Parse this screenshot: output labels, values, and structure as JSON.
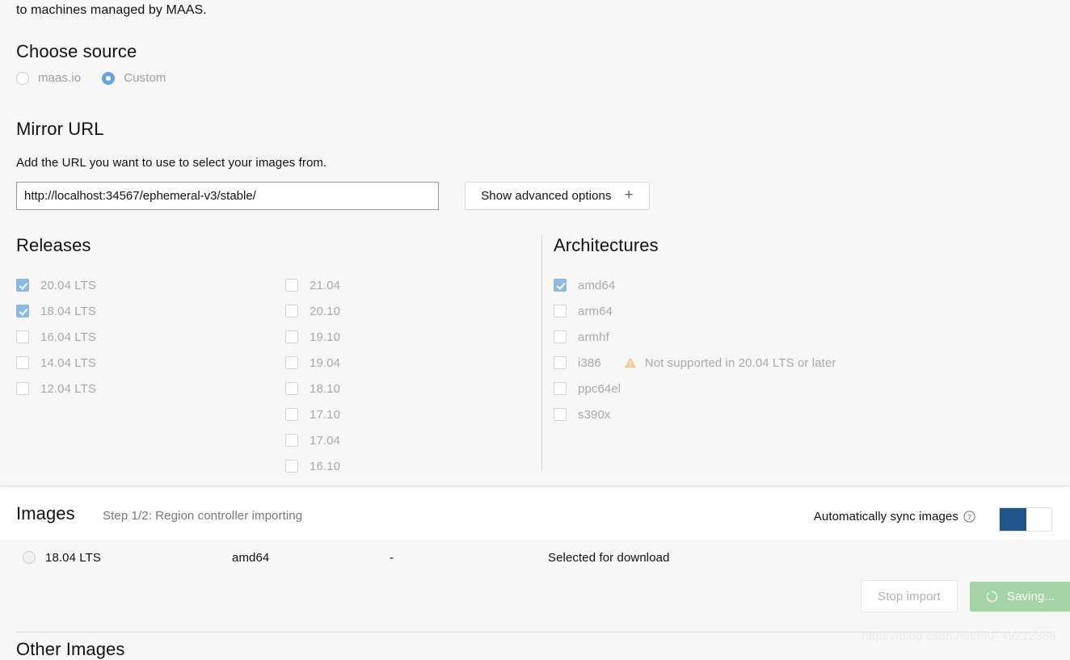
{
  "intro": {
    "text": "to machines managed by MAAS."
  },
  "choose_source": {
    "title": "Choose source",
    "options": [
      {
        "label": "maas.io",
        "selected": false
      },
      {
        "label": "Custom",
        "selected": true
      }
    ]
  },
  "mirror_url": {
    "title": "Mirror URL",
    "help": "Add the URL you want to use to select your images from.",
    "input_value": "http://localhost:34567/ephemeral-v3/stable/",
    "input_placeholder": "",
    "advanced_button": "Show advanced options",
    "advanced_icon": "plus-icon"
  },
  "releases": {
    "title": "Releases",
    "column_a": [
      {
        "label": "20.04 LTS",
        "checked": true
      },
      {
        "label": "18.04 LTS",
        "checked": true
      },
      {
        "label": "16.04 LTS",
        "checked": false
      },
      {
        "label": "14.04 LTS",
        "checked": false
      },
      {
        "label": "12.04 LTS",
        "checked": false
      }
    ],
    "column_b": [
      {
        "label": "21.04",
        "checked": false
      },
      {
        "label": "20.10",
        "checked": false
      },
      {
        "label": "19.10",
        "checked": false
      },
      {
        "label": "19.04",
        "checked": false
      },
      {
        "label": "18.10",
        "checked": false
      },
      {
        "label": "17.10",
        "checked": false
      },
      {
        "label": "17.04",
        "checked": false
      },
      {
        "label": "16.10",
        "checked": false
      }
    ]
  },
  "architectures": {
    "title": "Architectures",
    "items": [
      {
        "label": "amd64",
        "checked": true,
        "warning": ""
      },
      {
        "label": "arm64",
        "checked": false,
        "warning": ""
      },
      {
        "label": "armhf",
        "checked": false,
        "warning": ""
      },
      {
        "label": "i386",
        "checked": false,
        "warning": "Not supported in 20.04 LTS or later"
      },
      {
        "label": "ppc64el",
        "checked": false,
        "warning": ""
      },
      {
        "label": "s390x",
        "checked": false,
        "warning": ""
      }
    ]
  },
  "images_bar": {
    "title": "Images",
    "step": "Step 1/2: Region controller importing",
    "sync_label": "Automatically sync images",
    "help_icon": "question-circle-icon",
    "toggle_on": true
  },
  "images_table": {
    "rows": [
      {
        "release": "18.04 LTS",
        "architecture": "amd64",
        "size": "-",
        "status": "Selected for download"
      }
    ]
  },
  "actions": {
    "stop_import": "Stop import",
    "saving": "Saving...",
    "saving_icon": "spinner-icon"
  },
  "other_images": {
    "title": "Other Images"
  },
  "watermark": {
    "text": "https://blog.csdn.net/m0_49212388"
  },
  "colors": {
    "page_background": "#f7f7f7",
    "bar_background": "#ffffff",
    "radio_selected": "#69a3dd",
    "checkbox_checked": "#8cb8e4",
    "toggle_on": "#20558a",
    "saving_button": "#a4d3a7",
    "warning": "#f3c08b",
    "muted_text": "#a9a9a9"
  }
}
